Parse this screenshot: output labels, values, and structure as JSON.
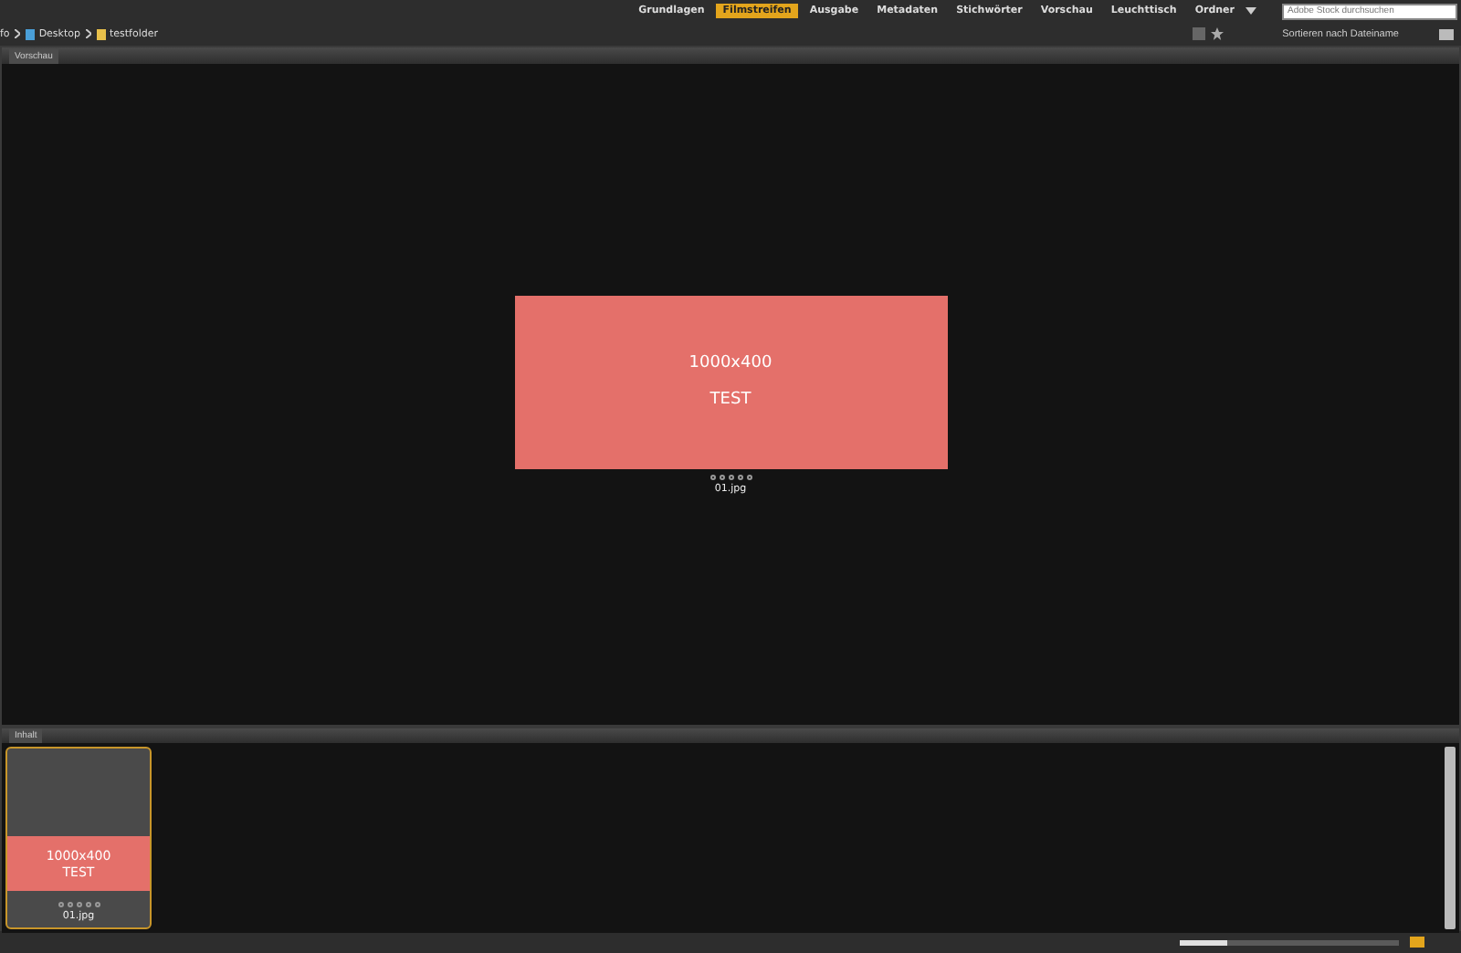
{
  "workspaces": [
    {
      "label": "Grundlagen",
      "selected": false
    },
    {
      "label": "Filmstreifen",
      "selected": true
    },
    {
      "label": "Ausgabe",
      "selected": false
    },
    {
      "label": "Metadaten",
      "selected": false
    },
    {
      "label": "Stichwörter",
      "selected": false
    },
    {
      "label": "Vorschau",
      "selected": false
    },
    {
      "label": "Leuchttisch",
      "selected": false
    },
    {
      "label": "Ordner",
      "selected": false
    }
  ],
  "search": {
    "placeholder": "Adobe Stock durchsuchen"
  },
  "breadcrumb": [
    "fo",
    "Desktop",
    "testfolder"
  ],
  "sort": {
    "label": "Sortieren nach Dateiname"
  },
  "zoom_slider": {
    "level": 0.22
  },
  "preview_panel": {
    "tab": "Vorschau",
    "image": {
      "lines": [
        "1000x400",
        "TEST"
      ]
    },
    "stars": 0,
    "filename": "01.jpg"
  },
  "content_panel": {
    "tab": "Inhalt",
    "items": [
      {
        "filename": "01.jpg",
        "stars": 0,
        "selected": true,
        "lines": [
          "1000x400",
          "TEST"
        ]
      }
    ]
  }
}
